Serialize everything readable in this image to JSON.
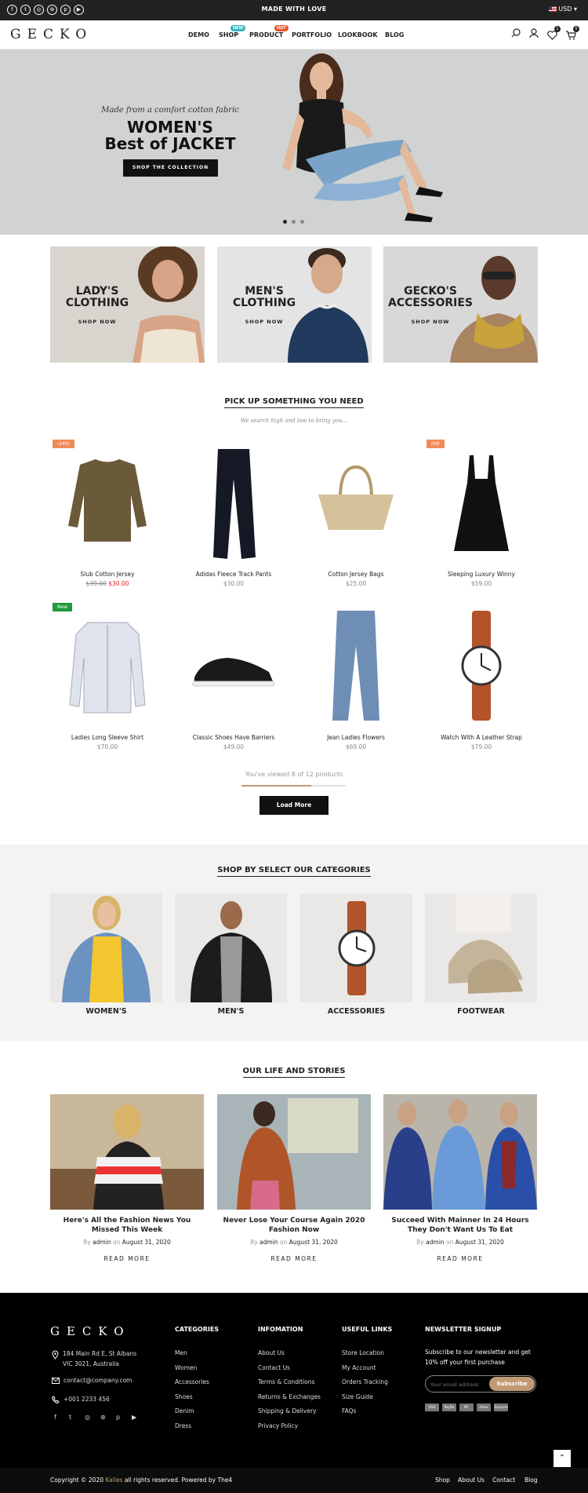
{
  "topbar": {
    "message": "MADE WITH LOVE",
    "currency": "USD",
    "social": [
      "facebook-icon",
      "twitter-icon",
      "instagram-icon",
      "dribbble-icon",
      "pinterest-icon",
      "youtube-icon"
    ]
  },
  "header": {
    "logo": "GECKO",
    "nav": [
      "DEMO",
      "SHOP",
      "PRODUCT",
      "PORTFOLIO",
      "LOOKBOOK",
      "BLOG"
    ],
    "shop_badge": "NEW",
    "product_badge": "HOT",
    "wishlist_count": "1",
    "cart_count": "0"
  },
  "hero": {
    "tagline": "Made from a comfort cotton fabric",
    "title_line1": "WOMEN'S",
    "title_line2": "Best of JACKET",
    "button": "SHOP THE COLLECTION"
  },
  "categories": [
    {
      "line1": "LADY'S",
      "line2": "CLOTHING",
      "cta": "SHOP NOW"
    },
    {
      "line1": "MEN'S",
      "line2": "CLOTHING",
      "cta": "SHOP NOW"
    },
    {
      "line1": "GECKO'S",
      "line2": "ACCESSORIES",
      "cta": "SHOP NOW"
    }
  ],
  "products_section": {
    "title": "PICK UP SOMETHING YOU NEED",
    "subtitle": "We search high and low to bring you...",
    "viewed": "You've viewed 8 of 12 products",
    "progress": 0.667,
    "load_more": "Load More"
  },
  "products": [
    {
      "name": "Slub Cotton Jersey",
      "old_price": "$39.00",
      "price": "$30.00",
      "label": "-24%"
    },
    {
      "name": "Adidas Fleece Track Pants",
      "price": "$30.00"
    },
    {
      "name": "Cotton Jersey Bags",
      "price": "$25.00"
    },
    {
      "name": "Sleeping Luxury Winny",
      "price": "$59.00",
      "label": "Hot"
    },
    {
      "name": "Ladies Long Sleeve Shirt",
      "price": "$70.00",
      "label": "New"
    },
    {
      "name": "Classic Shoes Have Barriers",
      "price": "$49.00"
    },
    {
      "name": "Jean Ladies Flowers",
      "price": "$69.00"
    },
    {
      "name": "Watch With A Leather Strap",
      "price": "$79.00"
    }
  ],
  "shop_categories": {
    "title": "SHOP BY SELECT OUR CATEGORIES",
    "items": [
      "WOMEN'S",
      "MEN'S",
      "ACCESSORIES",
      "FOOTWEAR"
    ]
  },
  "stories": {
    "title": "OUR LIFE AND STORIES",
    "read_more": "READ MORE",
    "by": "By",
    "on": "on",
    "posts": [
      {
        "title": "Here's All the Fashion News You Missed This Week",
        "author": "admin",
        "date": "August 31, 2020"
      },
      {
        "title": "Never Lose Your Course Again 2020 Fashion Now",
        "author": "admin",
        "date": "August 31, 2020"
      },
      {
        "title": "Succeed With Mainner In 24 Hours They Don't Want Us To Eat",
        "author": "admin",
        "date": "August 31, 2020"
      }
    ]
  },
  "footer": {
    "logo": "GECKO",
    "address1": "184 Main Rd E, St Albans",
    "address2": "VIC 3021, Australia",
    "email": "contact@company.com",
    "phone": "+001 2233 456",
    "categories_title": "CATEGORIES",
    "categories": [
      "Men",
      "Women",
      "Accessories",
      "Shoes",
      "Denim",
      "Dress"
    ],
    "info_title": "INFOMATION",
    "info": [
      "About Us",
      "Contact Us",
      "Terms & Conditions",
      "Returns & Exchanges",
      "Shipping & Delivery",
      "Privacy Policy"
    ],
    "links_title": "USEFUL LINKS",
    "links": [
      "Store Location",
      "My Account",
      "Orders Tracking",
      "Size Guide",
      "FAQs"
    ],
    "newsletter_title": "NEWSLETTER SIGNUP",
    "newsletter_text1": "Subscribe to our newsletter and get",
    "newsletter_text2": "10% off your first purchase",
    "email_placeholder": "Your email address",
    "subscribe": "Subscribe",
    "payments": [
      "VISA",
      "PayPal",
      "MC",
      "Amex",
      "Discover"
    ],
    "copyright_pre": "Copyright © 2020 ",
    "copyright_brand": "Kalles",
    "copyright_post": " all rights reserved. Powered by The4",
    "bottom_links": [
      "Shop",
      "About Us",
      "Contact",
      "Blog"
    ]
  },
  "colors": {
    "accent": "#c19a74",
    "sale": "#e02020",
    "badge_new": "#35b8c0",
    "badge_hot": "#e9542e",
    "label_sale": "#f08b59",
    "label_new": "#1f9a3c"
  }
}
